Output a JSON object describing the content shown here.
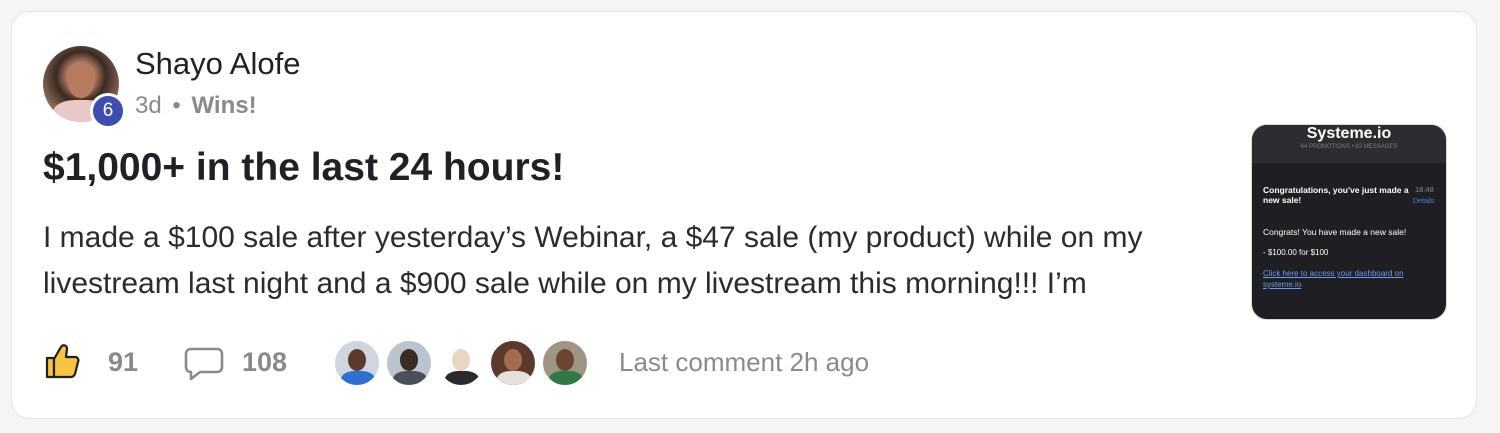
{
  "post": {
    "author": "Shayo Alofe",
    "level": "6",
    "age": "3d",
    "separator": "•",
    "category": "Wins!",
    "title": "$1,000+ in the last 24 hours!",
    "body": "I made a $100 sale after yesterday’s Webinar, a $47 sale (my product) while on my livestream last night and a $900 sale while on my livestream this morning!!! I’m"
  },
  "footer": {
    "likes": "91",
    "comments": "108",
    "last_comment": "Last comment 2h ago",
    "like_icon": "thumbs-up-icon",
    "comment_icon": "speech-bubble-icon"
  },
  "thumbnail": {
    "title": "Systeme.io",
    "subtitle": "64 PROMOTIONS • 83 MESSAGES",
    "headline": "Congratulations, you've just made a new sale!",
    "time": "18:48",
    "details": "Details",
    "message": "Congrats! You have made a new sale!",
    "amount": "- $100.00 for $100",
    "link": "Click here to access your dashboard on systeme.io"
  },
  "colors": {
    "badge": "#3d4eb3",
    "muted": "#8a8a8a",
    "like_icon_fill": "#f6c343",
    "thumbnail_bg": "#1e1f22"
  }
}
